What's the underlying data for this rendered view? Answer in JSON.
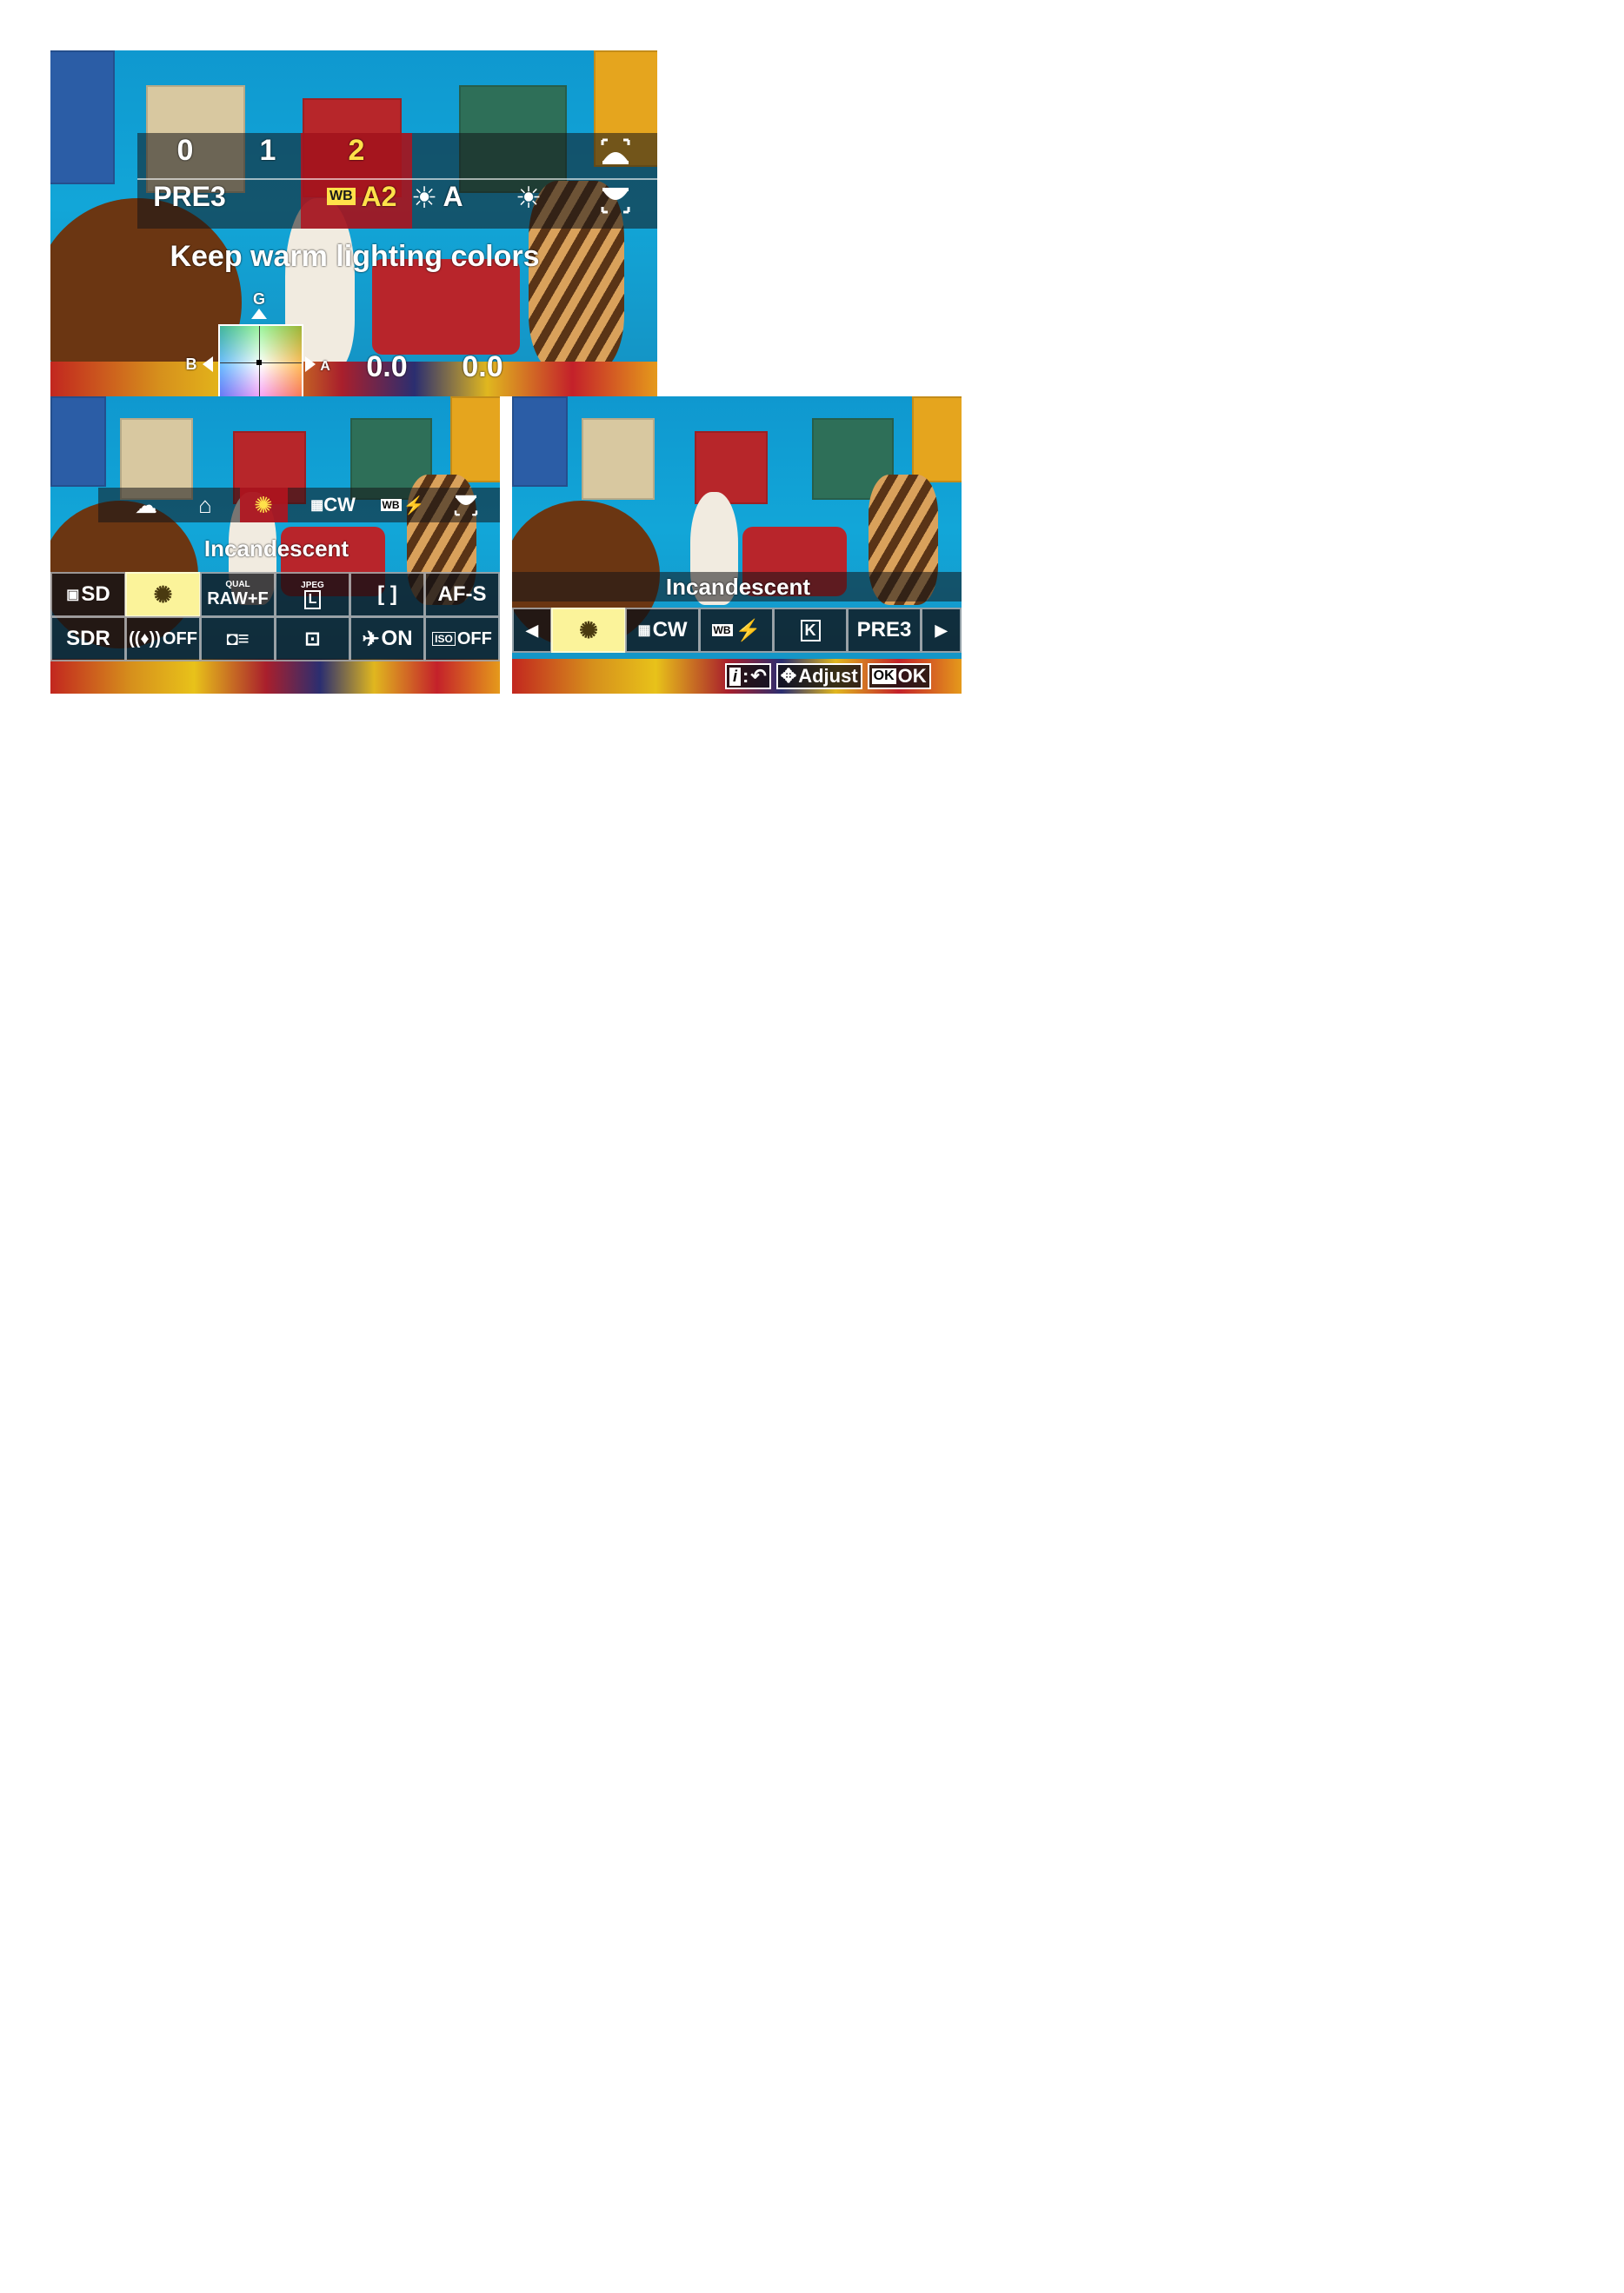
{
  "screen1": {
    "columns": [
      "0",
      "1",
      "2"
    ],
    "row2": {
      "left": "PRE3",
      "wb_badge": "WB",
      "wb_value": "A2",
      "mid": "A"
    },
    "caption": "Keep warm lighting colors",
    "grid": {
      "top_label": "G",
      "left_label": "B",
      "right_label": "A"
    },
    "values": [
      "0.0",
      "0.0"
    ],
    "icons": [
      "bracket-up-icon",
      "bracket-down-icon",
      "sun-icon",
      "sun-icon"
    ]
  },
  "screen2": {
    "wb_strip_icons": [
      "cloud-icon",
      "shade-icon",
      "incandescent-icon",
      "fluorescent-icon",
      "flash-icon",
      "bracket-down-icon"
    ],
    "wb_strip_labels": {
      "fluorescent": "CW",
      "flash_badge": "WB"
    },
    "caption": "Incandescent",
    "grid_row1": [
      "SD",
      "",
      "RAW+F",
      "L",
      "[ ]",
      "AF-S"
    ],
    "grid_row1_small": {
      "raw": "QUAL",
      "jpg": "JPEG"
    },
    "grid_row2": [
      "SDR",
      "OFF",
      "",
      "",
      "ON",
      "OFF"
    ]
  },
  "screen3": {
    "caption": "Incandescent",
    "options": [
      "",
      "CW",
      "",
      "K",
      "PRE3"
    ],
    "flash_badge": "WB",
    "footer": {
      "back": ":",
      "adjust": "Adjust",
      "ok_badge": "OK",
      "ok": "OK"
    }
  },
  "colors": {
    "selected": "#fbf39a",
    "highlight_red": "#b5121b",
    "accent_yellow": "#ffe14a"
  }
}
